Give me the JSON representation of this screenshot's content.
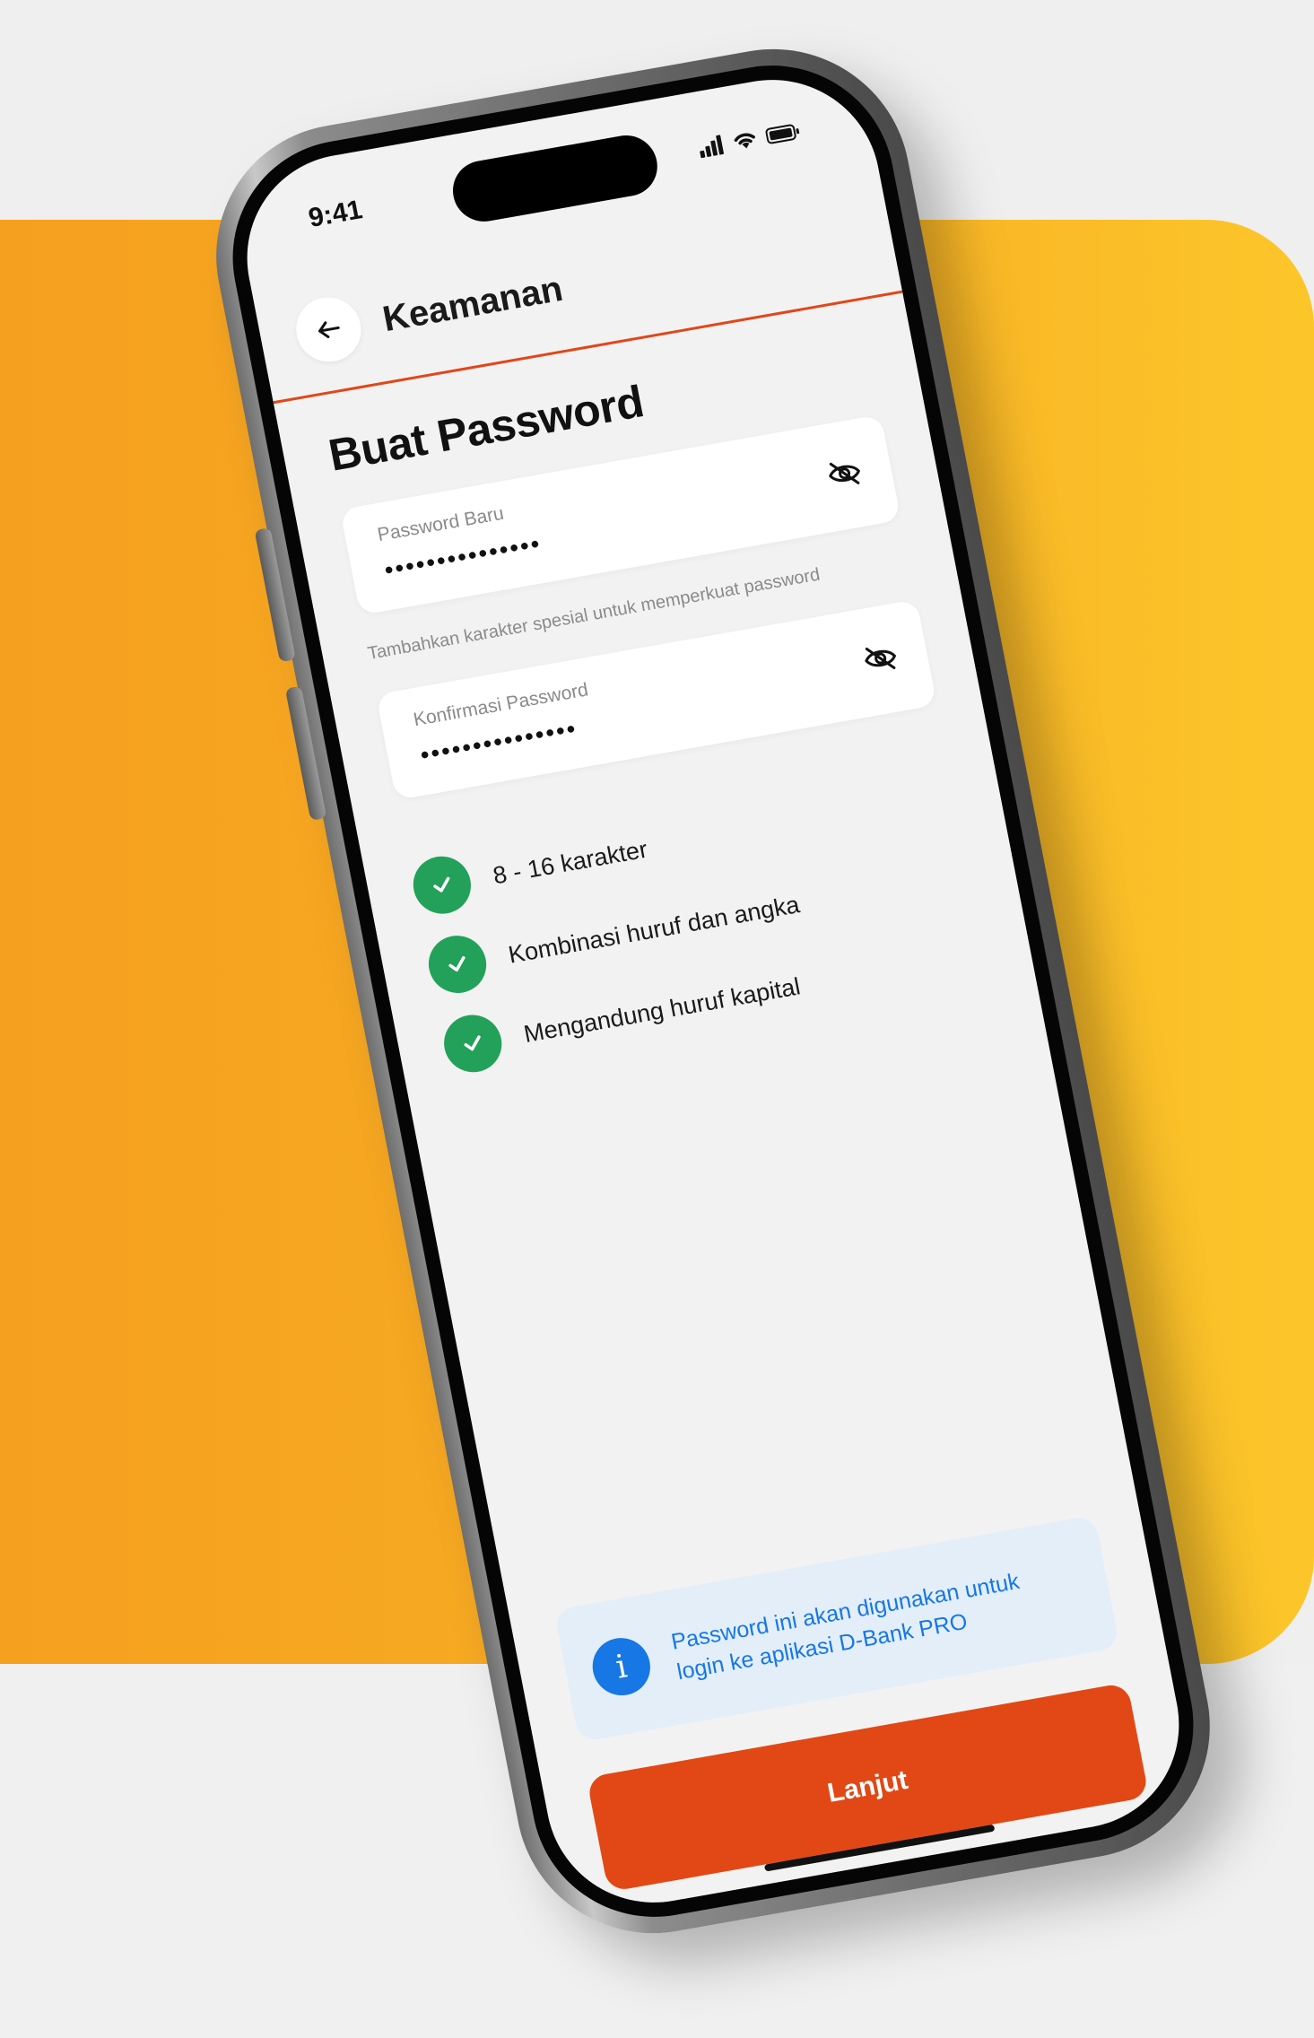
{
  "colors": {
    "accent": "#e24815",
    "divider": "#e2461a",
    "success": "#23a15a",
    "info": "#1677e5",
    "info_bg": "#e3eef9",
    "background_orange": "#f7ae24",
    "background_yellow": "#fcc62a"
  },
  "status_bar": {
    "time": "9:41",
    "icons": [
      "signal-icon",
      "wifi-icon",
      "battery-icon"
    ]
  },
  "header": {
    "back_icon": "arrow-left-icon",
    "title": "Keamanan"
  },
  "page": {
    "title": "Buat Password"
  },
  "new_password": {
    "label": "Password Baru",
    "value": "•••••••••••••••",
    "toggle_icon": "eye-off-icon",
    "hint": "Tambahkan karakter spesial untuk memperkuat password"
  },
  "confirm_password": {
    "label": "Konfirmasi Password",
    "value": "•••••••••••••••",
    "toggle_icon": "eye-off-icon"
  },
  "requirements": [
    {
      "label": "8 - 16 karakter",
      "met": true,
      "icon": "check-icon"
    },
    {
      "label": "Kombinasi huruf dan angka",
      "met": true,
      "icon": "check-icon"
    },
    {
      "label": "Mengandung huruf kapital",
      "met": true,
      "icon": "check-icon"
    }
  ],
  "info": {
    "icon": "info-icon",
    "line1": "Password ini akan digunakan untuk",
    "line2": "login ke aplikasi D-Bank PRO"
  },
  "actions": {
    "continue_label": "Lanjut"
  }
}
